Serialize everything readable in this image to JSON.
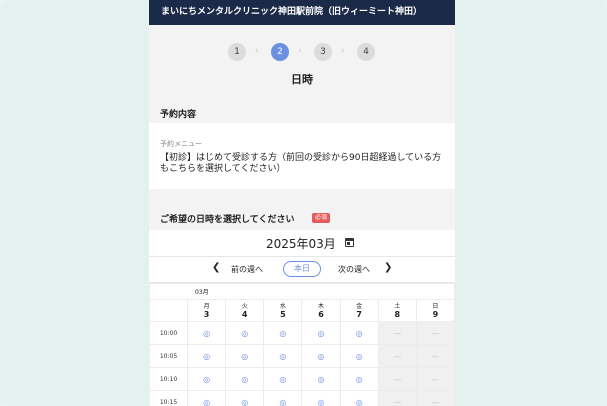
{
  "header": {
    "title": "まいにちメンタルクリニック神田駅前院（旧ウィーミート神田）"
  },
  "steps": [
    {
      "label": "1",
      "active": false
    },
    {
      "label": "2",
      "active": true
    },
    {
      "label": "3",
      "active": false
    },
    {
      "label": "4",
      "active": false
    }
  ],
  "page_title": "日時",
  "reservation": {
    "section_title": "予約内容",
    "menu_label": "予約メニュー",
    "menu_value": "【初診】はじめて受診する方（前回の受診から90日超経過している方もこちらを選択してください）"
  },
  "datetime": {
    "section_title": "ご希望の日時を選択してください",
    "required_badge": "必須"
  },
  "calendar": {
    "month_title": "2025年03月",
    "prev_week": "前の週へ",
    "today": "本日",
    "next_week": "次の週へ",
    "month_short": "03月",
    "days": [
      {
        "dow": "月",
        "date": "3"
      },
      {
        "dow": "火",
        "date": "4"
      },
      {
        "dow": "水",
        "date": "5"
      },
      {
        "dow": "木",
        "date": "6"
      },
      {
        "dow": "金",
        "date": "7"
      },
      {
        "dow": "土",
        "date": "8"
      },
      {
        "dow": "日",
        "date": "9"
      }
    ],
    "available_mark": "◎",
    "unavailable_mark": "—",
    "times": [
      "10:00",
      "10:05",
      "10:10",
      "10:15"
    ]
  },
  "colors": {
    "header_bg": "#1c2a4a",
    "accent": "#6c8fe3",
    "required": "#e25b5b",
    "saturday": "#4f76d8",
    "sunday": "#d84f4f"
  }
}
